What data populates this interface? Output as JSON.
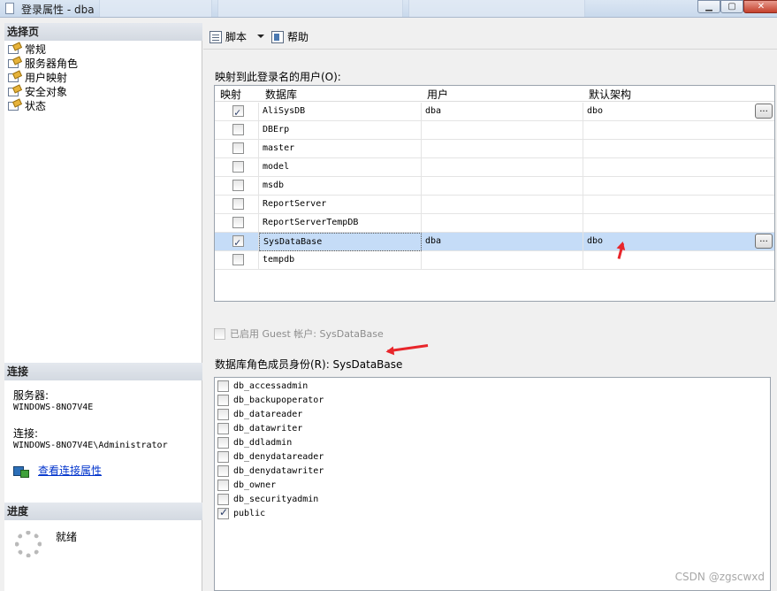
{
  "window": {
    "title": "登录属性 - dba"
  },
  "left_panel": {
    "select_page_header": "选择页",
    "nav_items": [
      {
        "label": "常规"
      },
      {
        "label": "服务器角色"
      },
      {
        "label": "用户映射"
      },
      {
        "label": "安全对象"
      },
      {
        "label": "状态"
      }
    ],
    "connection_header": "连接",
    "server_label": "服务器:",
    "server_value": "WINDOWS-8NO7V4E",
    "connection_label": "连接:",
    "connection_value": "WINDOWS-8NO7V4E\\Administrator",
    "view_connection_link": "查看连接属性",
    "progress_header": "进度",
    "progress_status": "就绪"
  },
  "toolbar": {
    "script_label": "脚本",
    "help_label": "帮助"
  },
  "mapping": {
    "title": "映射到此登录名的用户(O):",
    "columns": [
      "映射",
      "数据库",
      "用户",
      "默认架构"
    ],
    "rows": [
      {
        "checked": true,
        "database": "AliSysDB",
        "user": "dba",
        "schema": "dbo",
        "browse": "..."
      },
      {
        "checked": false,
        "database": "DBErp",
        "user": "",
        "schema": "",
        "browse": ""
      },
      {
        "checked": false,
        "database": "master",
        "user": "",
        "schema": "",
        "browse": ""
      },
      {
        "checked": false,
        "database": "model",
        "user": "",
        "schema": "",
        "browse": ""
      },
      {
        "checked": false,
        "database": "msdb",
        "user": "",
        "schema": "",
        "browse": ""
      },
      {
        "checked": false,
        "database": "ReportServer",
        "user": "",
        "schema": "",
        "browse": ""
      },
      {
        "checked": false,
        "database": "ReportServerTempDB",
        "user": "",
        "schema": "",
        "browse": ""
      },
      {
        "checked": true,
        "database": "SysDataBase",
        "user": "dba",
        "schema": "dbo",
        "browse": "...",
        "selected": true
      },
      {
        "checked": false,
        "database": "tempdb",
        "user": "",
        "schema": "",
        "browse": ""
      }
    ]
  },
  "guest": {
    "label": "已启用 Guest 帐户: SysDataBase",
    "checked": false,
    "enabled": false
  },
  "roles": {
    "title": "数据库角色成员身份(R): SysDataBase",
    "items": [
      {
        "label": "db_accessadmin",
        "checked": false
      },
      {
        "label": "db_backupoperator",
        "checked": false
      },
      {
        "label": "db_datareader",
        "checked": false
      },
      {
        "label": "db_datawriter",
        "checked": false
      },
      {
        "label": "db_ddladmin",
        "checked": false
      },
      {
        "label": "db_denydatareader",
        "checked": false
      },
      {
        "label": "db_denydatawriter",
        "checked": false
      },
      {
        "label": "db_owner",
        "checked": false
      },
      {
        "label": "db_securityadmin",
        "checked": false
      },
      {
        "label": "public",
        "checked": true
      }
    ]
  },
  "watermark": "CSDN @zgscwxd",
  "colors": {
    "selected_row": "#c5dcf7",
    "annotation_arrow": "#e8262b",
    "link": "#0033cc"
  }
}
